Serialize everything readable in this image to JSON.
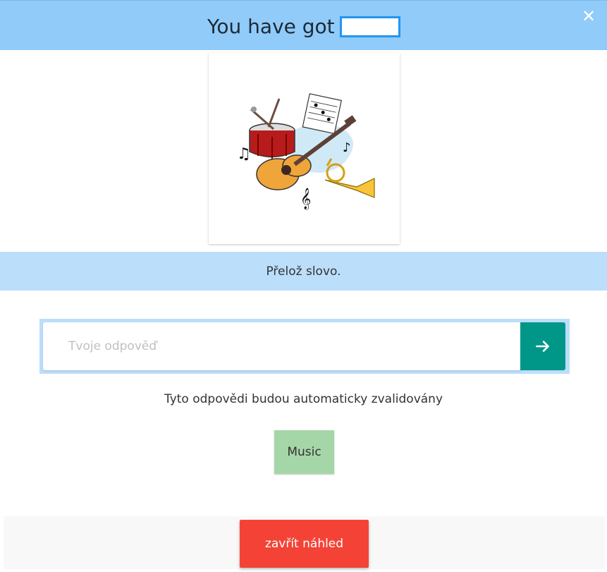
{
  "header": {
    "title": "You have got",
    "close_icon": "close-icon"
  },
  "prompt": {
    "text": "Přelož slovo."
  },
  "answer": {
    "placeholder": "Tvoje odpověď",
    "value": "",
    "submit_icon": "arrow-right-icon"
  },
  "hint": {
    "text": "Tyto odpovědi budou automaticky zvalidovány"
  },
  "chip": {
    "label": "Music"
  },
  "footer": {
    "close_label": "zavřít náhled"
  },
  "colors": {
    "header_bg": "#90cbf9",
    "band_bg": "#bbdefb",
    "submit_bg": "#009688",
    "chip_bg": "#a5d6a7",
    "close_bg": "#f44336"
  }
}
